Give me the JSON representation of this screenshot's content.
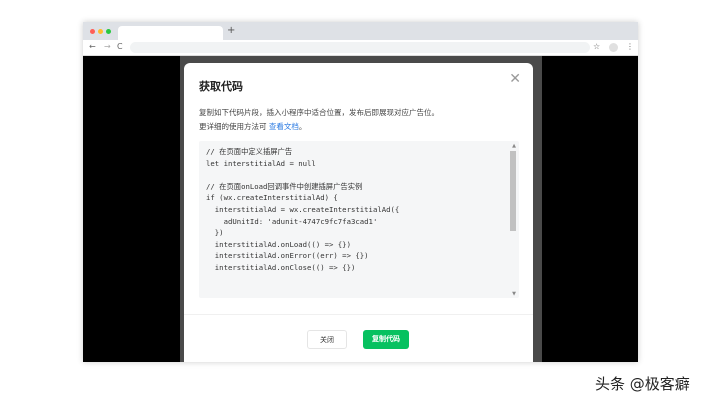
{
  "browser": {
    "new_tab": "+",
    "back": "←",
    "forward": "→",
    "reload": "C",
    "star": "☆",
    "menu": "⋮"
  },
  "modal": {
    "title": "获取代码",
    "close": "✕",
    "desc_line1": "复制如下代码片段，插入小程序中适合位置，发布后即展现对应广告位。",
    "desc_line2_prefix": "更详细的使用方法可 ",
    "doc_link": "查看文档",
    "desc_line2_suffix": "。",
    "code": "// 在页面中定义插屏广告\nlet interstitialAd = null\n\n// 在页面onLoad回调事件中创建插屏广告实例\nif (wx.createInterstitialAd) {\n  interstitialAd = wx.createInterstitialAd({\n    adUnitId: 'adunit-4747c9fc7fa3cad1'\n  })\n  interstitialAd.onLoad(() => {})\n  interstitialAd.onError((err) => {})\n  interstitialAd.onClose(() => {})",
    "close_button": "关闭",
    "copy_button": "复制代码"
  },
  "watermark": "头条 @极客癖"
}
